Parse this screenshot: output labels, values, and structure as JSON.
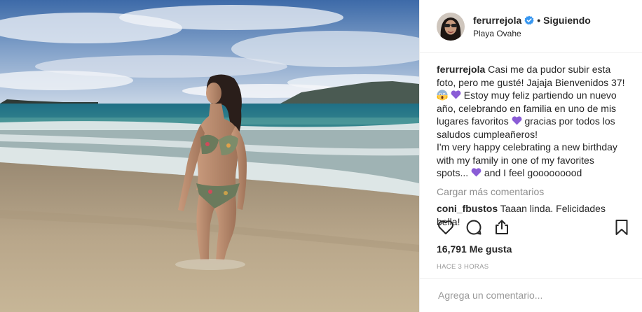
{
  "post": {
    "author": {
      "username": "ferurrejola",
      "verified": true,
      "follow_status": "Siguiendo",
      "location": "Playa Ovahe",
      "avatar_icon": "profile-avatar"
    },
    "caption": {
      "username": "ferurrejola",
      "line1": "Casi me da pudor subir esta foto, pero me gusté! Jajaja Bienvenidos 37!",
      "emoji1": "😱",
      "line2": "Estoy muy feliz partiendo un nuevo año, celebrando en familia en uno de mis lugares favoritos",
      "line3": "gracias por todos los saludos cumpleañeros!",
      "line4": "I'm very happy celebrating a new birthday with my family in one of my favorites spots...",
      "line5": "and I feel gooooooood"
    },
    "load_more_label": "Cargar más comentarios",
    "comments": [
      {
        "username": "coni_fbustos",
        "text": "Taaan linda. Felicidades bella!"
      }
    ],
    "likes_label": "16,791 Me gusta",
    "time_ago": "Hace 3 horas",
    "comment_placeholder": "Agrega un comentario...",
    "icons": [
      "heart-icon",
      "comment-icon",
      "share-icon",
      "bookmark-icon",
      "verified-badge-icon"
    ],
    "colors": {
      "verified_blue": "#3897f0",
      "purple_heart": "#8a5cd6",
      "muted": "#8e8e8e"
    }
  }
}
